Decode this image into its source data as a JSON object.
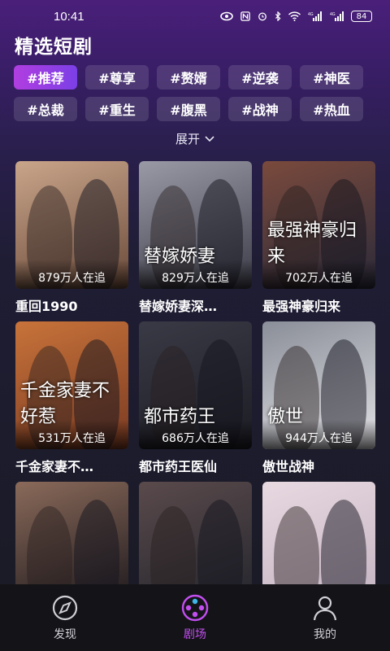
{
  "status_bar": {
    "time": "10:41",
    "battery": "84",
    "icons": [
      "eye-icon",
      "nfc-icon",
      "alarm-icon",
      "bluetooth-icon",
      "wifi-icon",
      "signal-4g-icon",
      "signal-4g-icon-2"
    ]
  },
  "page": {
    "title": "精选短剧"
  },
  "tags": {
    "items": [
      "#推荐",
      "#尊享",
      "#赘婿",
      "#逆袭",
      "#神医",
      "#总裁",
      "#重生",
      "#腹黑",
      "#战神",
      "#热血"
    ],
    "active_index": 0
  },
  "expand_label": "展开",
  "dramas": [
    {
      "title": "重回1990",
      "views": "879万人在追",
      "poster_text": "",
      "colors": [
        "#c9a58a",
        "#6a4a3a"
      ]
    },
    {
      "title": "替嫁娇妻深…",
      "views": "829万人在追",
      "poster_text": "替嫁娇妻",
      "colors": [
        "#9a9aa6",
        "#3c3c48"
      ]
    },
    {
      "title": "最强神豪归来",
      "views": "702万人在追",
      "poster_text": "最强神豪归来",
      "colors": [
        "#7a4a3c",
        "#2b2a3a"
      ]
    },
    {
      "title": "千金家妻不…",
      "views": "531万人在追",
      "poster_text": "千金家妻不好惹",
      "colors": [
        "#c8733a",
        "#7a3a22"
      ]
    },
    {
      "title": "都市药王医仙",
      "views": "686万人在追",
      "poster_text": "都市药王",
      "colors": [
        "#3a3a46",
        "#1c1c24"
      ]
    },
    {
      "title": "傲世战神",
      "views": "944万人在追",
      "poster_text": "傲世",
      "colors": [
        "#8a8e98",
        "#e2e2e6"
      ]
    },
    {
      "title": "",
      "views": "",
      "poster_text": "",
      "colors": [
        "#8a6a5a",
        "#2a2224"
      ]
    },
    {
      "title": "",
      "views": "",
      "poster_text": "",
      "colors": [
        "#5a4a4c",
        "#2a2a30"
      ]
    },
    {
      "title": "",
      "views": "",
      "poster_text": "",
      "colors": [
        "#e8d8e0",
        "#c8b8c6"
      ]
    }
  ],
  "bottom_nav": [
    {
      "label": "发现",
      "icon": "compass-icon",
      "active": false
    },
    {
      "label": "剧场",
      "icon": "film-reel-icon",
      "active": true
    },
    {
      "label": "我的",
      "icon": "person-icon",
      "active": false
    }
  ],
  "colors": {
    "accent": "#c24ef0",
    "tag_active": "#9a3fe3",
    "background": "#1a1a24"
  }
}
